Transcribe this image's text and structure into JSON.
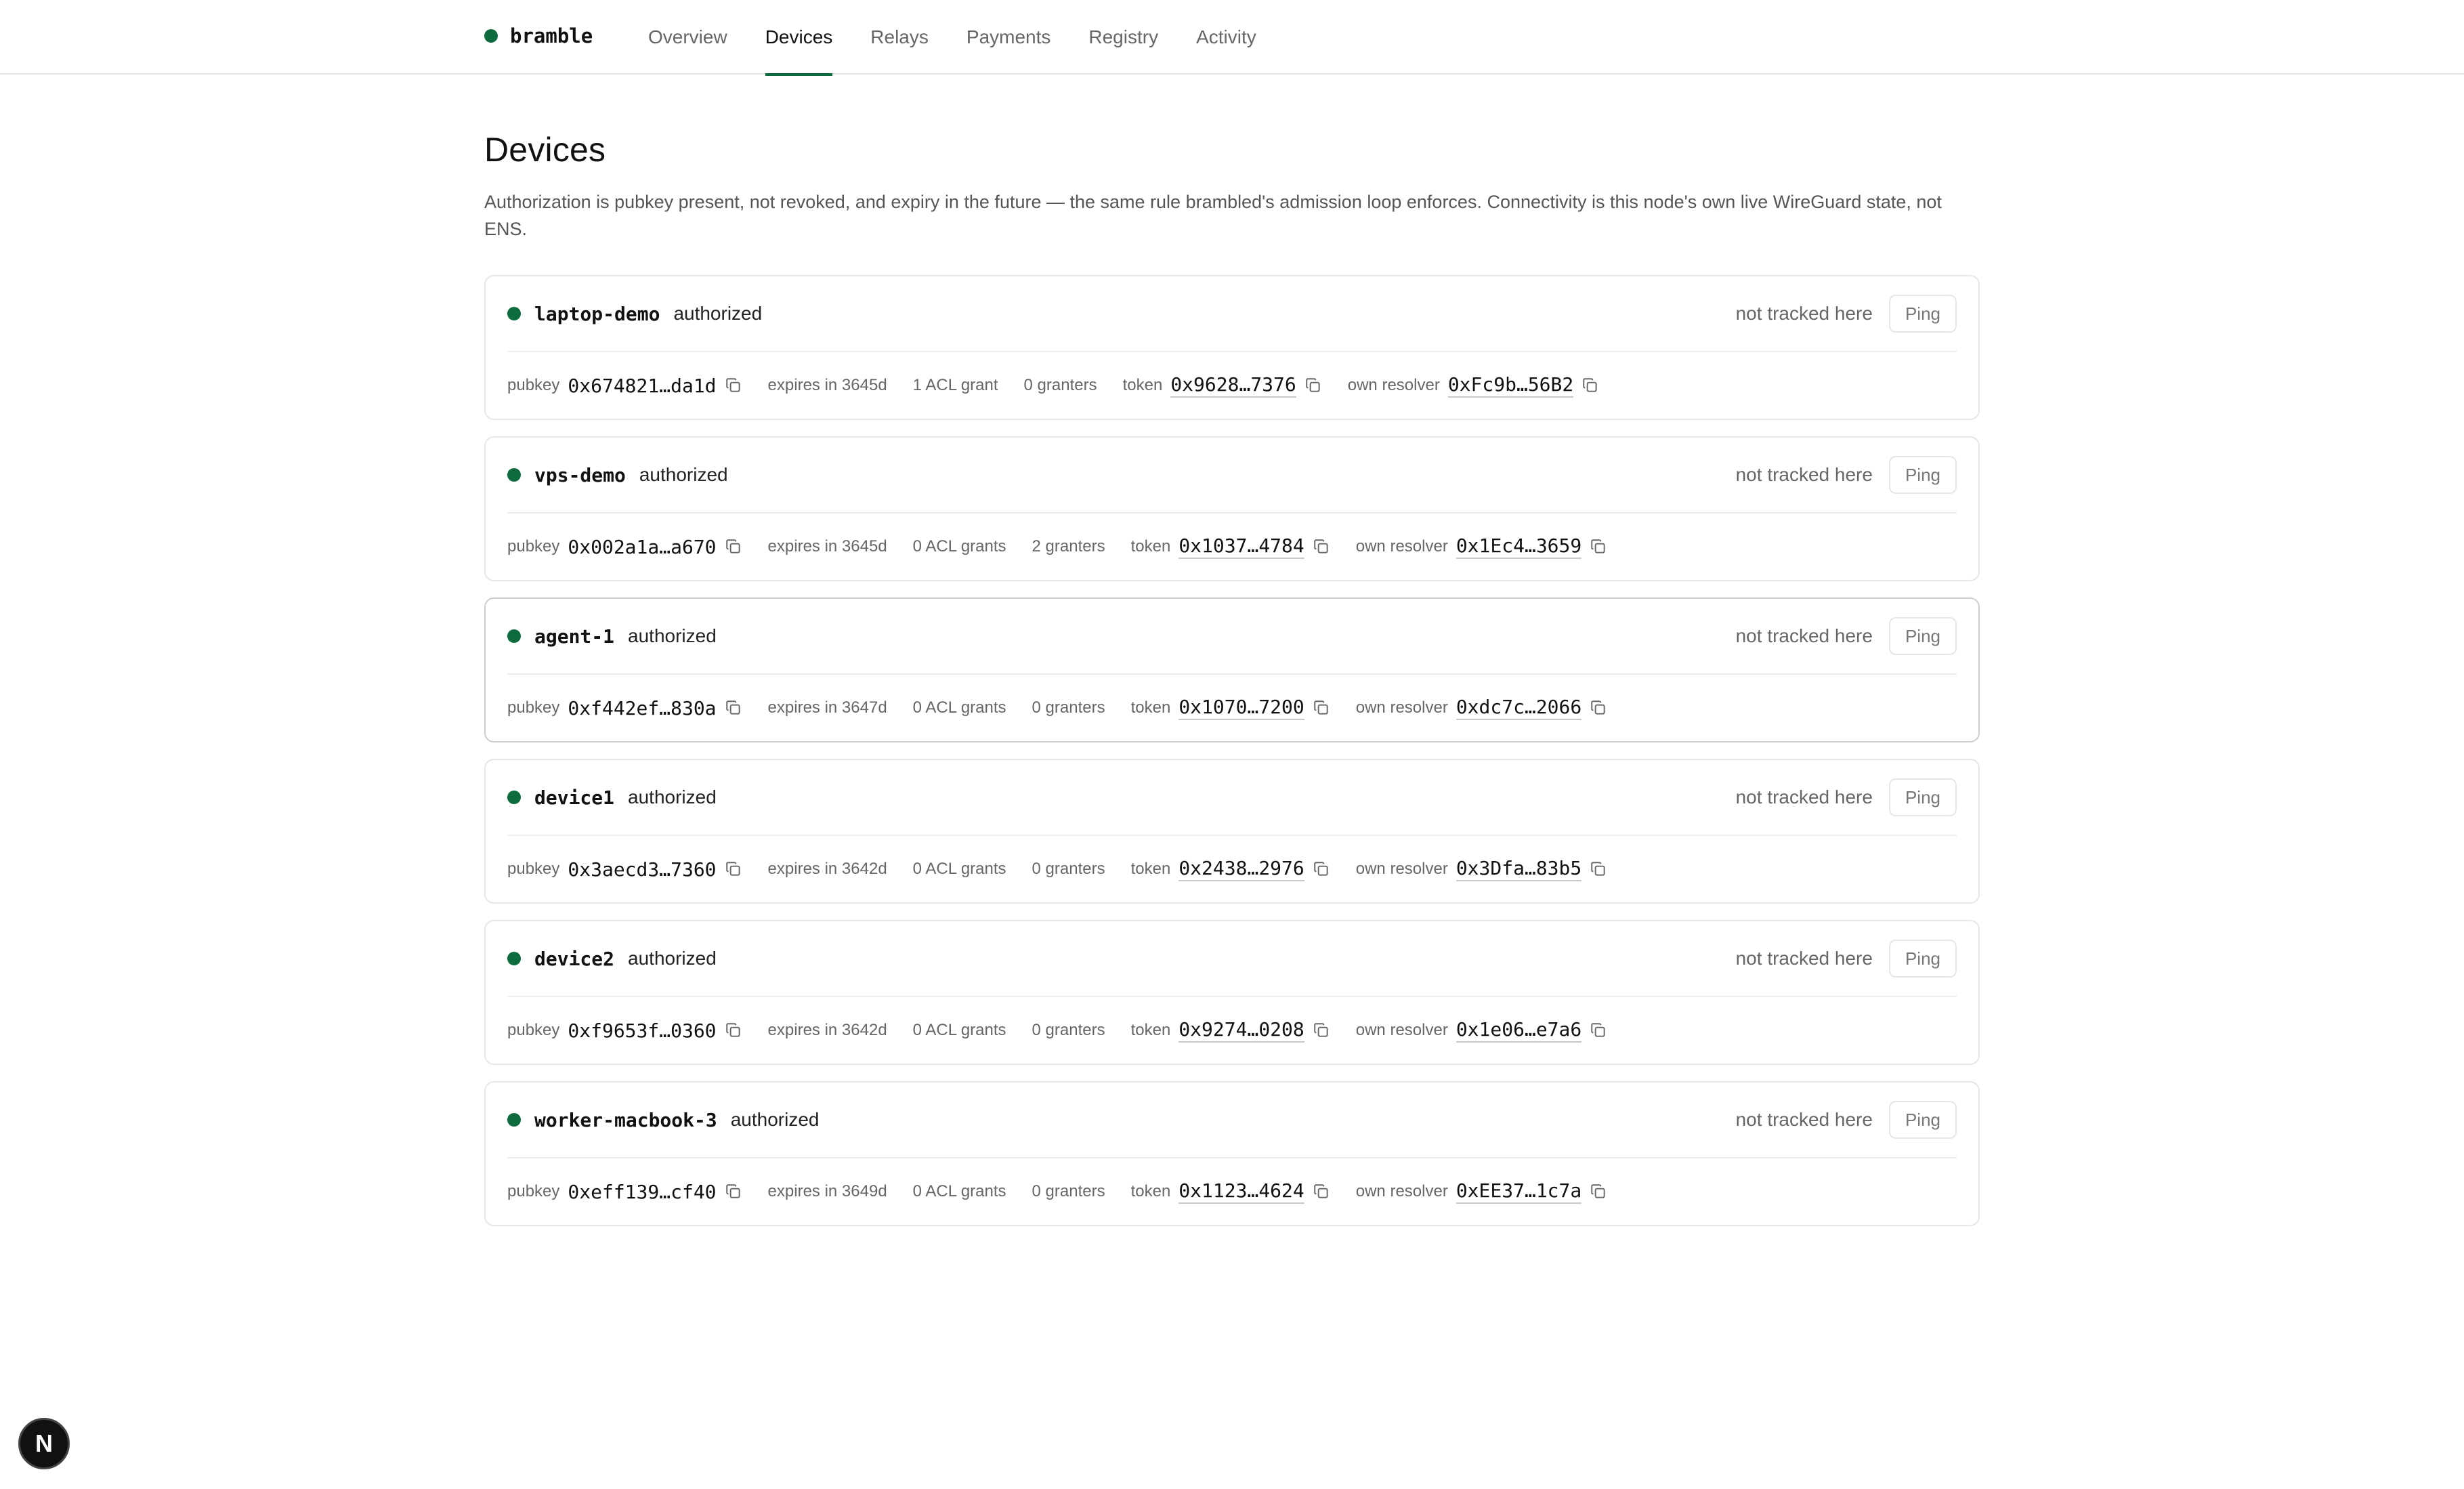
{
  "nav": {
    "brand": "bramble",
    "tabs": [
      {
        "label": "Overview"
      },
      {
        "label": "Devices"
      },
      {
        "label": "Relays"
      },
      {
        "label": "Payments"
      },
      {
        "label": "Registry"
      },
      {
        "label": "Activity"
      }
    ],
    "active_tab": "Devices"
  },
  "page": {
    "title": "Devices",
    "description": "Authorization is pubkey present, not revoked, and expiry in the future — the same rule brambled's admission loop enforces. Connectivity is this node's own live WireGuard state, not ENS."
  },
  "labels": {
    "pubkey": "pubkey",
    "token": "token",
    "own_resolver": "own resolver",
    "ping": "Ping"
  },
  "devices": [
    {
      "name": "laptop-demo",
      "status": "authorized",
      "connectivity": "not tracked here",
      "pubkey": "0x674821…da1d",
      "expires": "expires in 3645d",
      "acl": "1 ACL grant",
      "granters": "0 granters",
      "token": "0x9628…7376",
      "resolver": "0xFc9b…56B2"
    },
    {
      "name": "vps-demo",
      "status": "authorized",
      "connectivity": "not tracked here",
      "pubkey": "0x002a1a…a670",
      "expires": "expires in 3645d",
      "acl": "0 ACL grants",
      "granters": "2 granters",
      "token": "0x1037…4784",
      "resolver": "0x1Ec4…3659"
    },
    {
      "name": "agent-1",
      "status": "authorized",
      "connectivity": "not tracked here",
      "pubkey": "0xf442ef…830a",
      "expires": "expires in 3647d",
      "acl": "0 ACL grants",
      "granters": "0 granters",
      "token": "0x1070…7200",
      "resolver": "0xdc7c…2066"
    },
    {
      "name": "device1",
      "status": "authorized",
      "connectivity": "not tracked here",
      "pubkey": "0x3aecd3…7360",
      "expires": "expires in 3642d",
      "acl": "0 ACL grants",
      "granters": "0 granters",
      "token": "0x2438…2976",
      "resolver": "0x3Dfa…83b5"
    },
    {
      "name": "device2",
      "status": "authorized",
      "connectivity": "not tracked here",
      "pubkey": "0xf9653f…0360",
      "expires": "expires in 3642d",
      "acl": "0 ACL grants",
      "granters": "0 granters",
      "token": "0x9274…0208",
      "resolver": "0x1e06…e7a6"
    },
    {
      "name": "worker-macbook-3",
      "status": "authorized",
      "connectivity": "not tracked here",
      "pubkey": "0xeff139…cf40",
      "expires": "expires in 3649d",
      "acl": "0 ACL grants",
      "granters": "0 granters",
      "token": "0x1123…4624",
      "resolver": "0xEE37…1c7a"
    }
  ],
  "badge": {
    "letter": "N"
  },
  "colors": {
    "status_dot": "#0e6b3e",
    "accent": "#0e6b3e",
    "border": "#e6e6e6"
  }
}
